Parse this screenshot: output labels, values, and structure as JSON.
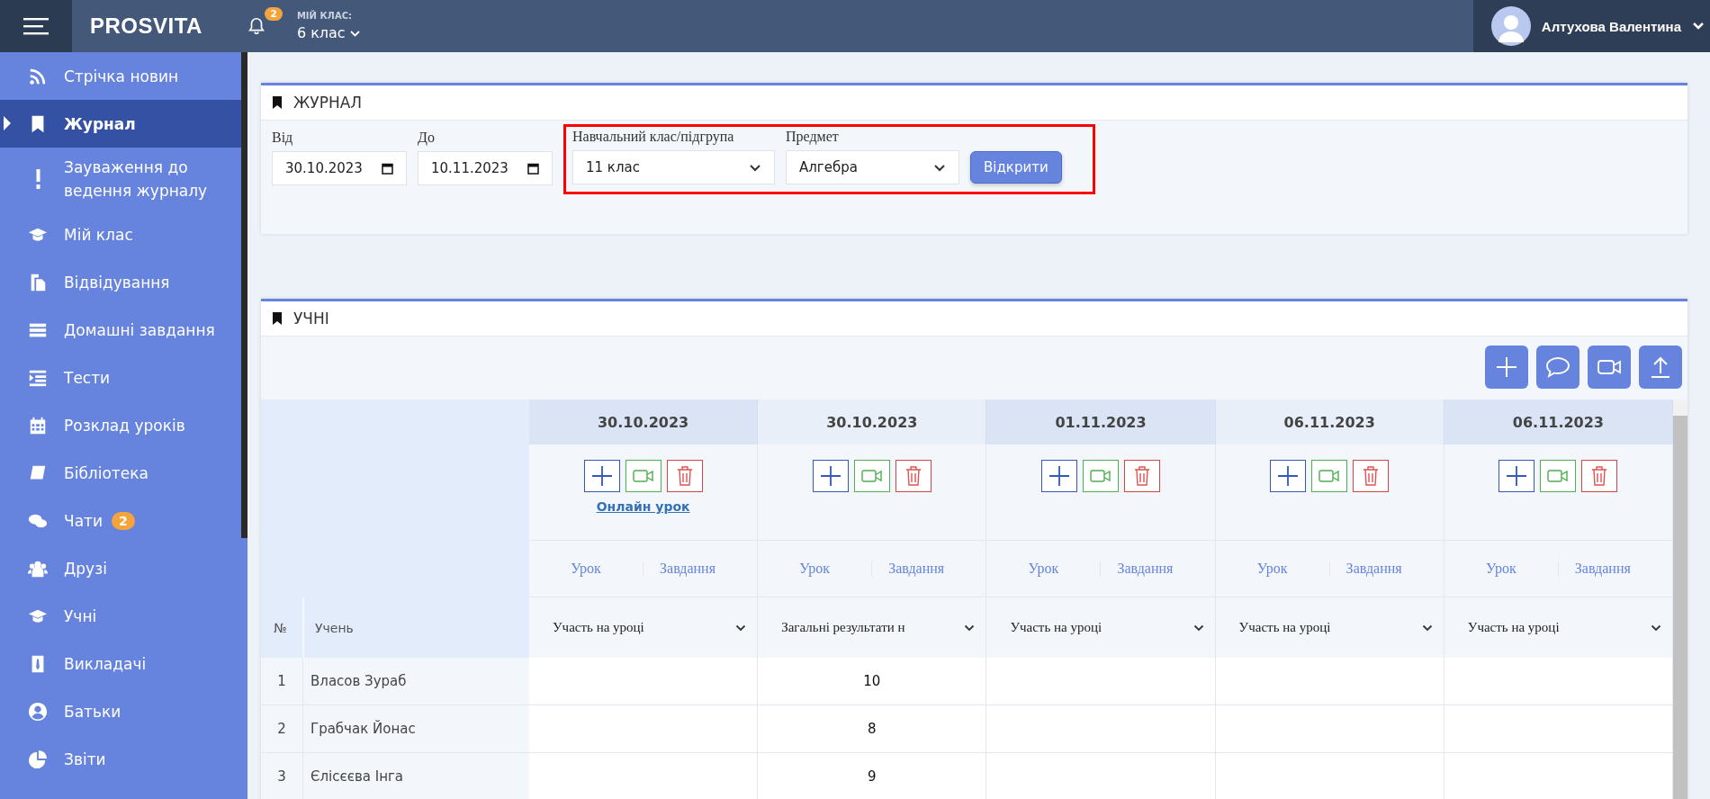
{
  "topbar": {
    "logo": "PROSVITA",
    "notifications": "2",
    "class_label": "МІЙ КЛАС:",
    "class_value": "6 клас",
    "user": "Алтухова Валентина"
  },
  "sidebar": {
    "items": [
      {
        "label": "Стрічка новин",
        "selected": false
      },
      {
        "label": "Журнал",
        "selected": true
      },
      {
        "label": "Зауваження до ведення журналу",
        "selected": false
      },
      {
        "label": "Мій клас",
        "selected": false
      },
      {
        "label": "Відвідування",
        "selected": false
      },
      {
        "label": "Домашні завдання",
        "selected": false
      },
      {
        "label": "Тести",
        "selected": false
      },
      {
        "label": "Розклад уроків",
        "selected": false
      },
      {
        "label": "Бібліотека",
        "selected": false
      },
      {
        "label": "Чати",
        "selected": false,
        "badge": "2"
      },
      {
        "label": "Друзі",
        "selected": false
      },
      {
        "label": "Учні",
        "selected": false
      },
      {
        "label": "Викладачі",
        "selected": false
      },
      {
        "label": "Батьки",
        "selected": false
      },
      {
        "label": "Звіти",
        "selected": false
      }
    ]
  },
  "journal": {
    "title": "ЖУРНАЛ",
    "from_label": "Від",
    "from_value": "30.10.2023",
    "to_label": "До",
    "to_value": "10.11.2023",
    "class_label": "Навчальний клас/підгрупа",
    "class_value": "11 клас",
    "subject_label": "Предмет",
    "subject_value": "Алгебра",
    "open_button": "Відкрити"
  },
  "students": {
    "title": "УЧНІ",
    "number_header": "№",
    "name_header": "Учень",
    "columns": [
      {
        "date": "30.10.2023",
        "online_link": "Онлайн урок",
        "tab_lesson": "Урок",
        "tab_task": "Завдання",
        "select": "Участь на уроці"
      },
      {
        "date": "30.10.2023",
        "tab_lesson": "Урок",
        "tab_task": "Завдання",
        "select": "Загальні результати н"
      },
      {
        "date": "01.11.2023",
        "tab_lesson": "Урок",
        "tab_task": "Завдання",
        "select": "Участь на уроці"
      },
      {
        "date": "06.11.2023",
        "tab_lesson": "Урок",
        "tab_task": "Завдання",
        "select": "Участь на уроці"
      },
      {
        "date": "06.11.2023",
        "tab_lesson": "Урок",
        "tab_task": "Завдання",
        "select": "Участь на уроці"
      }
    ],
    "rows": [
      {
        "number": "1",
        "name": "Власов Зураб",
        "grades": {
          "column_2": "10"
        }
      },
      {
        "number": "2",
        "name": "Грабчак Йонас",
        "grades": {
          "column_2": "8"
        }
      },
      {
        "number": "3",
        "name": "Єлісєєва Інга",
        "grades": {
          "column_2": "9"
        }
      }
    ]
  }
}
